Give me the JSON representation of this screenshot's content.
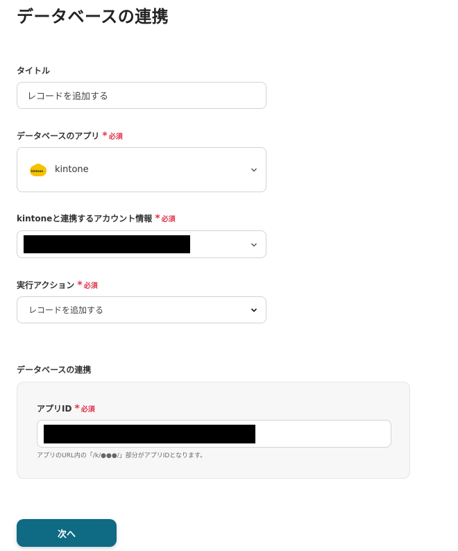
{
  "page": {
    "title": "データベースの連携"
  },
  "required_label": "必須",
  "fields": {
    "title": {
      "label": "タイトル",
      "value": "レコードを追加する"
    },
    "app": {
      "label": "データベースのアプリ",
      "value": "kintone",
      "logo_text": "kintone",
      "icon": "kintone-logo"
    },
    "account": {
      "label": "kintoneと連携するアカウント情報",
      "value_redacted": true
    },
    "action": {
      "label": "実行アクション",
      "value": "レコードを追加する"
    }
  },
  "database_section": {
    "title": "データベースの連携",
    "app_id": {
      "label": "アプリID",
      "value_redacted": true,
      "hint": "アプリのURL内の「/k/●●●/」部分がアプリIDとなります。"
    }
  },
  "buttons": {
    "next": "次へ"
  },
  "colors": {
    "accent": "#0f6a84",
    "required": "#e0344b",
    "logo": "#f5c200"
  }
}
